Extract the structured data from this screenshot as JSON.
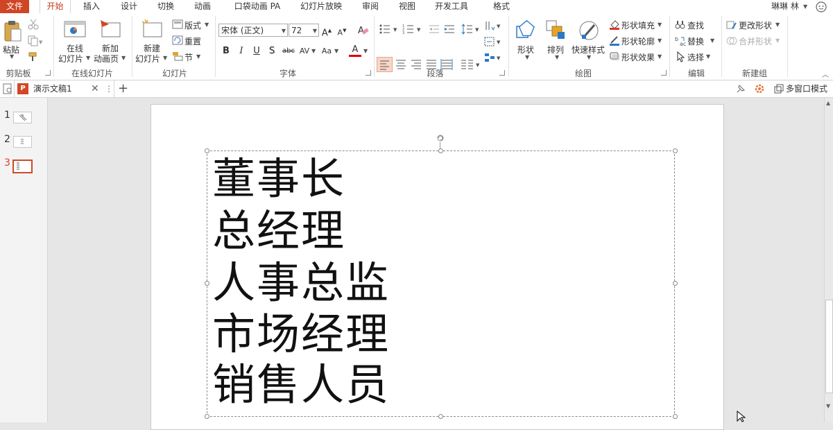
{
  "tabs": [
    {
      "label": "文件",
      "kind": "file"
    },
    {
      "label": "开始",
      "kind": "active"
    },
    {
      "label": "插入"
    },
    {
      "label": "设计"
    },
    {
      "label": "切换"
    },
    {
      "label": "动画"
    },
    {
      "label": "口袋动画 PA"
    },
    {
      "label": "幻灯片放映"
    },
    {
      "label": "审阅"
    },
    {
      "label": "视图"
    },
    {
      "label": "开发工具"
    },
    {
      "label": "格式"
    }
  ],
  "user": {
    "name": "琳琳 林"
  },
  "ribbon": {
    "clipboard": {
      "paste": "粘贴",
      "group": "剪贴板"
    },
    "online": {
      "online_slides_1": "在线",
      "online_slides_2": "幻灯片",
      "new_anim_1": "新加",
      "new_anim_2": "动画页",
      "group": "在线幻灯片"
    },
    "slides": {
      "new_slide_1": "新建",
      "new_slide_2": "幻灯片",
      "layout": "版式",
      "reset": "重置",
      "section": "节",
      "group": "幻灯片"
    },
    "font": {
      "font_name": "宋体 (正文)",
      "font_size": "72",
      "bold": "B",
      "italic": "I",
      "underline": "U",
      "shadow": "S",
      "strike": "abc",
      "spacing": "AV",
      "case": "Aa",
      "color_a": "A",
      "grow": "A",
      "shrink": "A",
      "group": "字体"
    },
    "paragraph": {
      "group": "段落"
    },
    "drawing": {
      "shapes": "形状",
      "arrange": "排列",
      "quick_styles": "快速样式",
      "fill": "形状填充",
      "outline": "形状轮廓",
      "effects": "形状效果",
      "group": "绘图"
    },
    "editing": {
      "find": "查找",
      "replace": "替换",
      "select": "选择",
      "group": "编辑"
    },
    "new_group": {
      "change_shape": "更改形状",
      "merge_shapes": "合并形状",
      "group": "新建组"
    }
  },
  "doc_tab": {
    "title": "演示文稿1",
    "multi_window": "多窗口模式"
  },
  "thumbnails": [
    {
      "number": "1",
      "active": false
    },
    {
      "number": "2",
      "active": false
    },
    {
      "number": "3",
      "active": true
    }
  ],
  "slide": {
    "lines": [
      "董事长",
      "总经理",
      "人事总监",
      "市场经理",
      "销售人员"
    ]
  },
  "colors": {
    "accent": "#c43e1c",
    "file_tab": "#d04525",
    "active_thumb": "#d24726"
  }
}
